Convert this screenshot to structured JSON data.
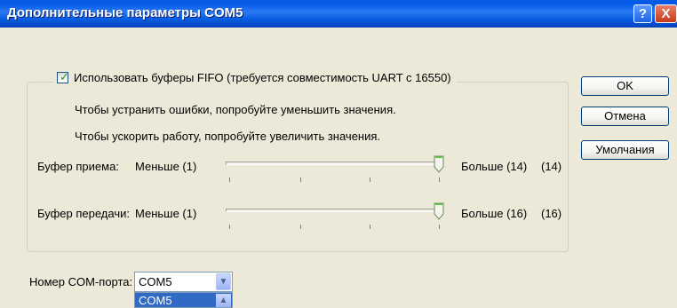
{
  "window": {
    "title": "Дополнительные параметры COM5",
    "help_label": "?",
    "close_label": "X"
  },
  "fifo": {
    "checked": true,
    "label": "Использовать буферы FIFO (требуется совместимость UART с 16550)"
  },
  "hints": {
    "reduce_errors": "Чтобы устранить ошибки, попробуйте уменьшить значения.",
    "speed_up": "Чтобы ускорить работу, попробуйте увеличить значения."
  },
  "receive_buffer": {
    "label": "Буфер приема:",
    "min_label": "Меньше (1)",
    "max_label": "Больше (14)",
    "value_label": "(14)",
    "value": 14,
    "min": 1,
    "max": 14
  },
  "transmit_buffer": {
    "label": "Буфер передачи:",
    "min_label": "Меньше (1)",
    "max_label": "Больше (16)",
    "value_label": "(16)",
    "value": 16,
    "min": 1,
    "max": 16
  },
  "buttons": {
    "ok": "OK",
    "cancel": "Отмена",
    "defaults": "Умолчания"
  },
  "com_port": {
    "label": "Номер COM-порта:",
    "selected": "COM5",
    "highlighted_option": "COM5"
  },
  "colors": {
    "titlebar": "#0a5ee4",
    "dialog_bg": "#ece9d8",
    "selection": "#316ac5",
    "check": "#21a121"
  }
}
